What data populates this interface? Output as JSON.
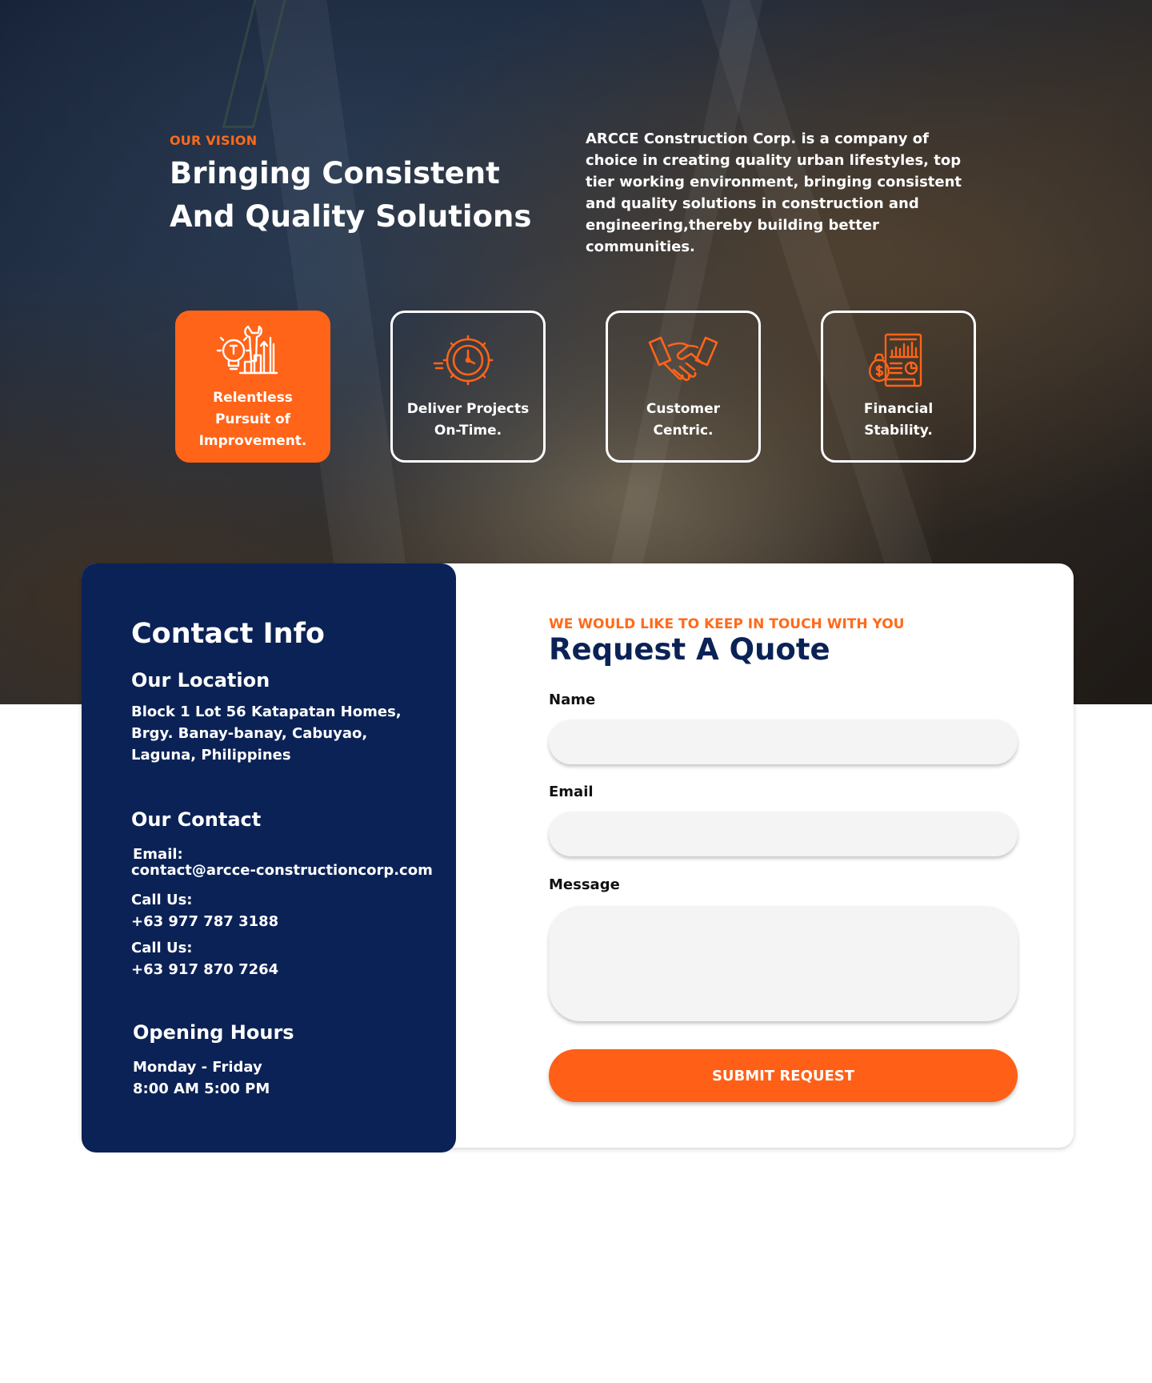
{
  "vision": {
    "tag": "OUR VISION",
    "title": "Bringing Consistent And Quality Solutions",
    "text": "ARCCE Construction Corp. is a company of choice in creating quality urban lifestyles, top tier working environment, bringing consistent and quality solutions in construction and engineering,thereby building better communities."
  },
  "values": [
    {
      "label": "Relentless Pursuit of Improvement.",
      "icon": "improvement-icon",
      "active": true
    },
    {
      "label": "Deliver Projects On-Time.",
      "icon": "clock-gear-icon",
      "active": false
    },
    {
      "label": "Customer Centric.",
      "icon": "handshake-icon",
      "active": false
    },
    {
      "label": "Financial Stability.",
      "icon": "finance-report-icon",
      "active": false
    }
  ],
  "contact": {
    "title": "Contact Info",
    "location_heading": "Our Location",
    "location_lines": [
      "Block 1 Lot 56 Katapatan Homes,",
      "Brgy. Banay-banay, Cabuyao,",
      "Laguna, Philippines"
    ],
    "contact_heading": "Our Contact",
    "email_label": "Email:",
    "email": "contact@arcce-constructioncorp.com",
    "phone1_label": "Call Us:",
    "phone1": "+63 977 787 3188",
    "phone2_label": "Call Us:",
    "phone2": "+63 917 870 7264",
    "hours_heading": "Opening Hours",
    "hours_days": "Monday - Friday",
    "hours_time": "8:00 AM  5:00 PM"
  },
  "form": {
    "tag": "WE WOULD LIKE TO KEEP IN TOUCH WITH YOU",
    "title": "Request A Quote",
    "name_label": "Name",
    "name_value": "",
    "email_label": "Email",
    "email_value": "",
    "message_label": "Message",
    "message_value": "",
    "submit_label": "SUBMIT REQUEST"
  },
  "colors": {
    "accent": "#ff6418",
    "navy": "#0b2256"
  }
}
